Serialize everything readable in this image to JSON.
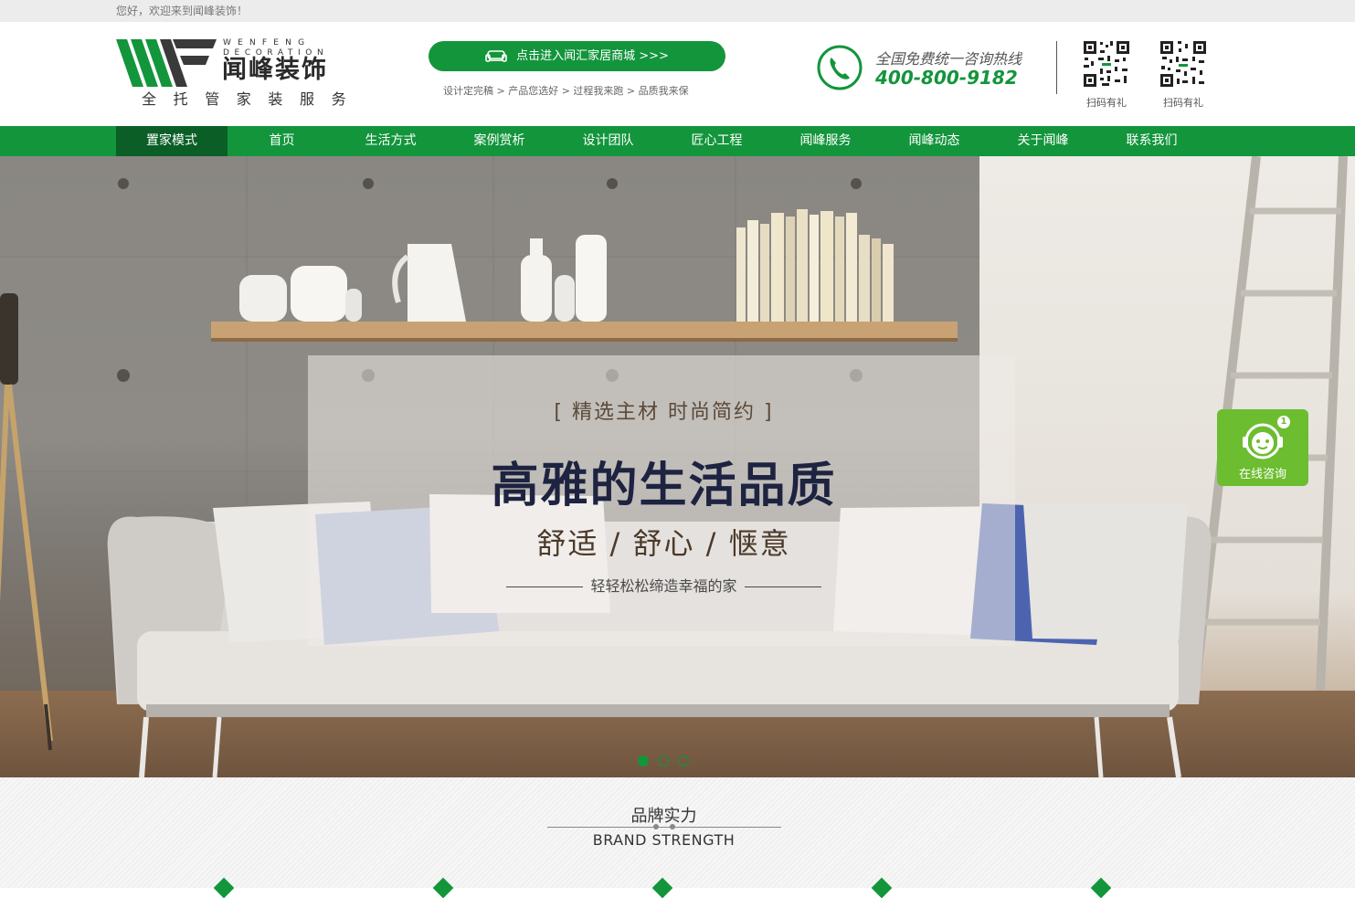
{
  "topbar": {
    "greeting": "您好，欢迎来到闻峰装饰！"
  },
  "logo": {
    "en_line1": "WENFENG",
    "en_line2": "DECORATION",
    "cn": "闻峰装饰",
    "slogan": "全托管家装服务",
    "mark_letters": "WF"
  },
  "header": {
    "mall_button": "点击进入闻汇家居商城 >>>",
    "steps": "设计定完稿 > 产品您选好 > 过程我来跑 > 品质我来保",
    "hotline_label": "全国免费统一咨询热线",
    "hotline_number": "400-800-9182",
    "qr": [
      {
        "caption": "扫码有礼"
      },
      {
        "caption": "扫码有礼"
      }
    ]
  },
  "nav": {
    "items": [
      {
        "label": "置家模式"
      },
      {
        "label": "首页"
      },
      {
        "label": "生活方式"
      },
      {
        "label": "案例赏析"
      },
      {
        "label": "设计团队"
      },
      {
        "label": "匠心工程"
      },
      {
        "label": "闻峰服务"
      },
      {
        "label": "闻峰动态"
      },
      {
        "label": "关于闻峰"
      },
      {
        "label": "联系我们"
      }
    ],
    "active_index": 0
  },
  "banner": {
    "subtitle": "[ 精选主材  时尚简约 ]",
    "title": "高雅的生活品质",
    "tagline": "舒适 / 舒心 / 惬意",
    "line": "轻轻松松缔造幸福的家",
    "slide_count": 3,
    "active_slide": 0
  },
  "consult": {
    "label": "在线咨询",
    "badge": "1"
  },
  "brand": {
    "title_cn": "品牌实力",
    "title_en": "BRAND STRENGTH"
  },
  "colors": {
    "brand_green": "#13953c",
    "nav_active": "#0a5e26",
    "consult_green": "#6cbd30"
  },
  "icons": [
    "sofa-icon",
    "phone-icon",
    "qr-code-icon",
    "customer-service-icon"
  ]
}
